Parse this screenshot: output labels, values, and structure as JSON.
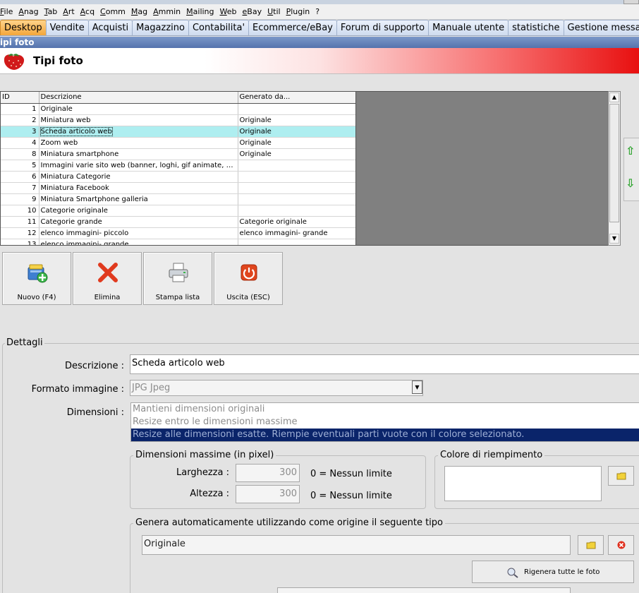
{
  "menubar": [
    "File",
    "Anag",
    "Tab",
    "Art",
    "Acq",
    "Comm",
    "Mag",
    "Ammin",
    "Mailing",
    "Web",
    "eBay",
    "Util",
    "Plugin",
    "?"
  ],
  "tabs": [
    "Desktop",
    "Vendite",
    "Acquisti",
    "Magazzino",
    "Contabilita'",
    "Ecommerce/eBay",
    "Forum di supporto",
    "Manuale utente",
    "statistiche",
    "Gestione messaggi"
  ],
  "window_caption": "ipi foto",
  "page_title": "Tipi foto",
  "grid": {
    "columns": [
      "ID",
      "Descrizione",
      "Generato da..."
    ],
    "rows": [
      [
        "1",
        "Originale",
        ""
      ],
      [
        "2",
        "Miniatura web",
        "Originale"
      ],
      [
        "3",
        "Scheda articolo web",
        "Originale"
      ],
      [
        "4",
        "Zoom web",
        "Originale"
      ],
      [
        "8",
        "Miniatura smartphone",
        "Originale"
      ],
      [
        "5",
        "Immagini varie sito web (banner, loghi, gif animate, fla...",
        ""
      ],
      [
        "6",
        "Miniatura Categorie",
        ""
      ],
      [
        "7",
        "Miniatura Facebook",
        ""
      ],
      [
        "9",
        "Miniatura Smartphone galleria",
        ""
      ],
      [
        "10",
        "Categorie originale",
        ""
      ],
      [
        "11",
        "Categorie grande",
        "Categorie originale"
      ],
      [
        "12",
        "elenco immagini- piccolo",
        "elenco immagini- grande"
      ],
      [
        "13",
        "elenco immagini- grande",
        ""
      ]
    ]
  },
  "toolbar": {
    "new_label": "Nuovo (F4)",
    "delete_label": "Elimina",
    "print_label": "Stampa lista",
    "exit_label": "Uscita (ESC)"
  },
  "details": {
    "legend": "Dettagli",
    "descrizione_label": "Descrizione :",
    "descrizione_value": "Scheda articolo web",
    "formato_label": "Formato immagine :",
    "formato_value": "JPG Jpeg",
    "dimensioni_label": "Dimensioni :",
    "dimensioni_options": [
      "Mantieni dimensioni originali",
      "Resize entro le dimensioni massime",
      "Resize alle dimensioni esatte. Riempie eventuali parti vuote con il colore selezionato."
    ],
    "dim_max_legend": "Dimensioni massime (in pixel)",
    "larghezza_label": "Larghezza :",
    "larghezza_value": "300",
    "altezza_label": "Altezza :",
    "altezza_value": "300",
    "nessun_limite": "0 = Nessun limite",
    "colore_legend": "Colore di riempimento",
    "genera_legend": "Genera automaticamente utilizzando come origine il seguente tipo",
    "origine_value": "Originale",
    "regen_label": "Rigenera tutte le foto"
  }
}
